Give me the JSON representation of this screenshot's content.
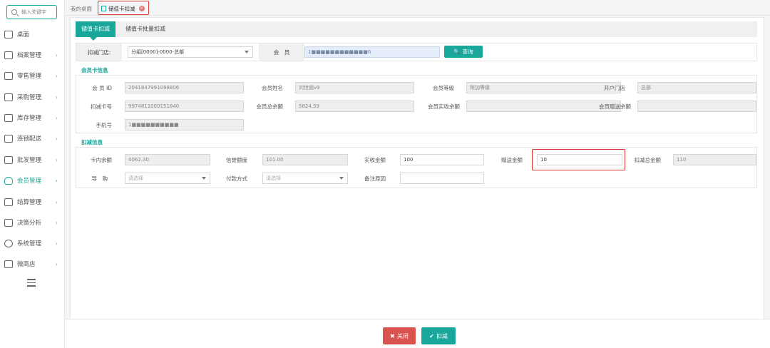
{
  "sidebar": {
    "search_placeholder": "输入关键字",
    "items": [
      {
        "label": "桌面",
        "chevron": ""
      },
      {
        "label": "档案管理",
        "chevron": "›"
      },
      {
        "label": "零售管理",
        "chevron": "›"
      },
      {
        "label": "采购管理",
        "chevron": "›"
      },
      {
        "label": "库存管理",
        "chevron": "›"
      },
      {
        "label": "连锁配送",
        "chevron": "›"
      },
      {
        "label": "批发管理",
        "chevron": "›"
      },
      {
        "label": "会员管理",
        "chevron": "›"
      },
      {
        "label": "结算管理",
        "chevron": "›"
      },
      {
        "label": "决策分析",
        "chevron": "›"
      },
      {
        "label": "系统管理",
        "chevron": "›"
      },
      {
        "label": "微商店",
        "chevron": "›"
      }
    ]
  },
  "tabs": {
    "home": "我的桌面",
    "active": "储值卡扣减",
    "close_glyph": "×"
  },
  "subtabs": {
    "tab1": "储值卡扣减",
    "tab2": "储值卡批量扣减"
  },
  "filter": {
    "store_label": "扣减门店:",
    "store_value": "分组[0000]-0000-总部",
    "member_label": "会　员",
    "member_value": "1■■■■■■■■■■■■6",
    "query_label": "查询",
    "query_icon": "🔍"
  },
  "card_info": {
    "title": "会员卡信息",
    "member_id_label": "会 员 ID",
    "member_id": "2041847991098806",
    "name_label": "会员姓名",
    "name": "刘世丽v9",
    "level_label": "会员等级",
    "level": "附加等级",
    "open_store_label": "开户门店",
    "open_store": "总部",
    "card_no_label": "扣减卡号",
    "card_no": "9974811000151640",
    "total_balance_label": "会员总余额",
    "total_balance": "5824.59",
    "real_balance_label": "会员实收余额",
    "real_balance": "",
    "gift_balance_label": "会员赠送余额",
    "gift_balance": "",
    "phone_label": "手机号",
    "phone": "1■■■■■■■■■■"
  },
  "deduct_info": {
    "title": "扣减信息",
    "card_balance_label": "卡内余额",
    "card_balance": "4062.30",
    "credit_label": "信誉额度",
    "credit": "101.00",
    "received_label": "实收金额",
    "received": "100",
    "gift_label": "赠送金额",
    "gift": "10",
    "total_label": "扣减总金额",
    "total": "110",
    "guide_label": "导　购",
    "guide_placeholder": "请选择",
    "pay_label": "付款方式",
    "pay_placeholder": "请选择",
    "remark_label": "备注原因",
    "remark": ""
  },
  "actions": {
    "close_label": "关闭",
    "close_icon": "✖",
    "deduct_label": "扣减",
    "deduct_icon": "✔"
  },
  "colors": {
    "accent": "#1aa79b",
    "danger": "#d9534f",
    "highlight": "#e53935"
  }
}
